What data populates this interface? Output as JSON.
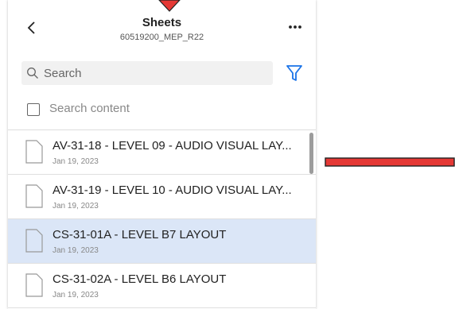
{
  "header": {
    "title": "Sheets",
    "subtitle": "60519200_MEP_R22"
  },
  "search": {
    "placeholder": "Search"
  },
  "search_content": {
    "label": "Search content",
    "checked": false
  },
  "sheets": [
    {
      "title": "AV-31-18 - LEVEL 09 - AUDIO VISUAL LAY...",
      "date": "Jan 19, 2023",
      "selected": false
    },
    {
      "title": "AV-31-19 - LEVEL 10 - AUDIO VISUAL LAY...",
      "date": "Jan 19, 2023",
      "selected": false
    },
    {
      "title": "CS-31-01A - LEVEL B7 LAYOUT",
      "date": "Jan 19, 2023",
      "selected": true
    },
    {
      "title": "CS-31-02A - LEVEL B6 LAYOUT",
      "date": "Jan 19, 2023",
      "selected": false
    }
  ],
  "icons": {
    "back": "chevron-left-icon",
    "more": "more-horizontal-icon",
    "search": "search-icon",
    "filter": "filter-icon",
    "document": "document-icon"
  },
  "colors": {
    "accent": "#1a73e8",
    "selected_row": "#dbe6f7",
    "annotation": "#e53935"
  }
}
